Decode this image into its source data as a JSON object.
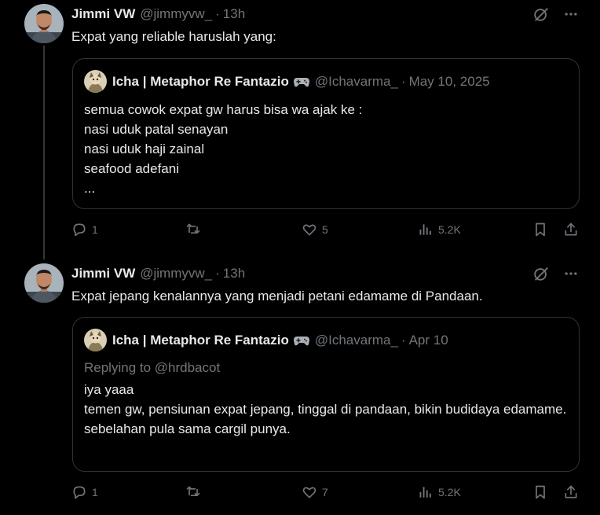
{
  "tweets": [
    {
      "author_name": "Jimmi VW",
      "author_handle": "@jimmyvw_",
      "separator": "·",
      "time": "13h",
      "text": "Expat yang reliable haruslah yang:",
      "quote": {
        "author_name": "Icha | Metaphor Re Fantazio",
        "author_handle": "@Ichavarma_",
        "separator": "·",
        "date": "May 10, 2025",
        "replying_to": "",
        "lines": [
          "semua cowok expat gw harus bisa wa ajak ke :",
          "nasi uduk patal senayan",
          "nasi uduk haji zainal",
          "seafood adefani",
          "..."
        ]
      },
      "stats": {
        "replies": "1",
        "reposts": "",
        "likes": "5",
        "views": "5.2K"
      }
    },
    {
      "author_name": "Jimmi VW",
      "author_handle": "@jimmyvw_",
      "separator": "·",
      "time": "13h",
      "text": "Expat jepang kenalannya yang menjadi petani edamame di Pandaan.",
      "quote": {
        "author_name": "Icha | Metaphor Re Fantazio",
        "author_handle": "@Ichavarma_",
        "separator": "·",
        "date": "Apr 10",
        "replying_to": "Replying to @hrdbacot",
        "lines": [
          "iya yaaa",
          "temen gw, pensiunan expat jepang, tinggal di pandaan, bikin budidaya edamame.",
          "sebelahan pula sama cargil punya."
        ]
      },
      "stats": {
        "replies": "1",
        "reposts": "",
        "likes": "7",
        "views": "5.2K"
      }
    }
  ],
  "icons": {
    "grok": "grok-icon",
    "more": "more-icon",
    "reply": "reply-icon",
    "repost": "repost-icon",
    "like": "heart-icon",
    "views": "views-icon",
    "bookmark": "bookmark-icon",
    "share": "share-icon",
    "gamepad": "gamepad-icon"
  },
  "colors": {
    "background": "#000000",
    "text": "#e7e9ea",
    "muted": "#71767b",
    "border": "#2f3336"
  }
}
